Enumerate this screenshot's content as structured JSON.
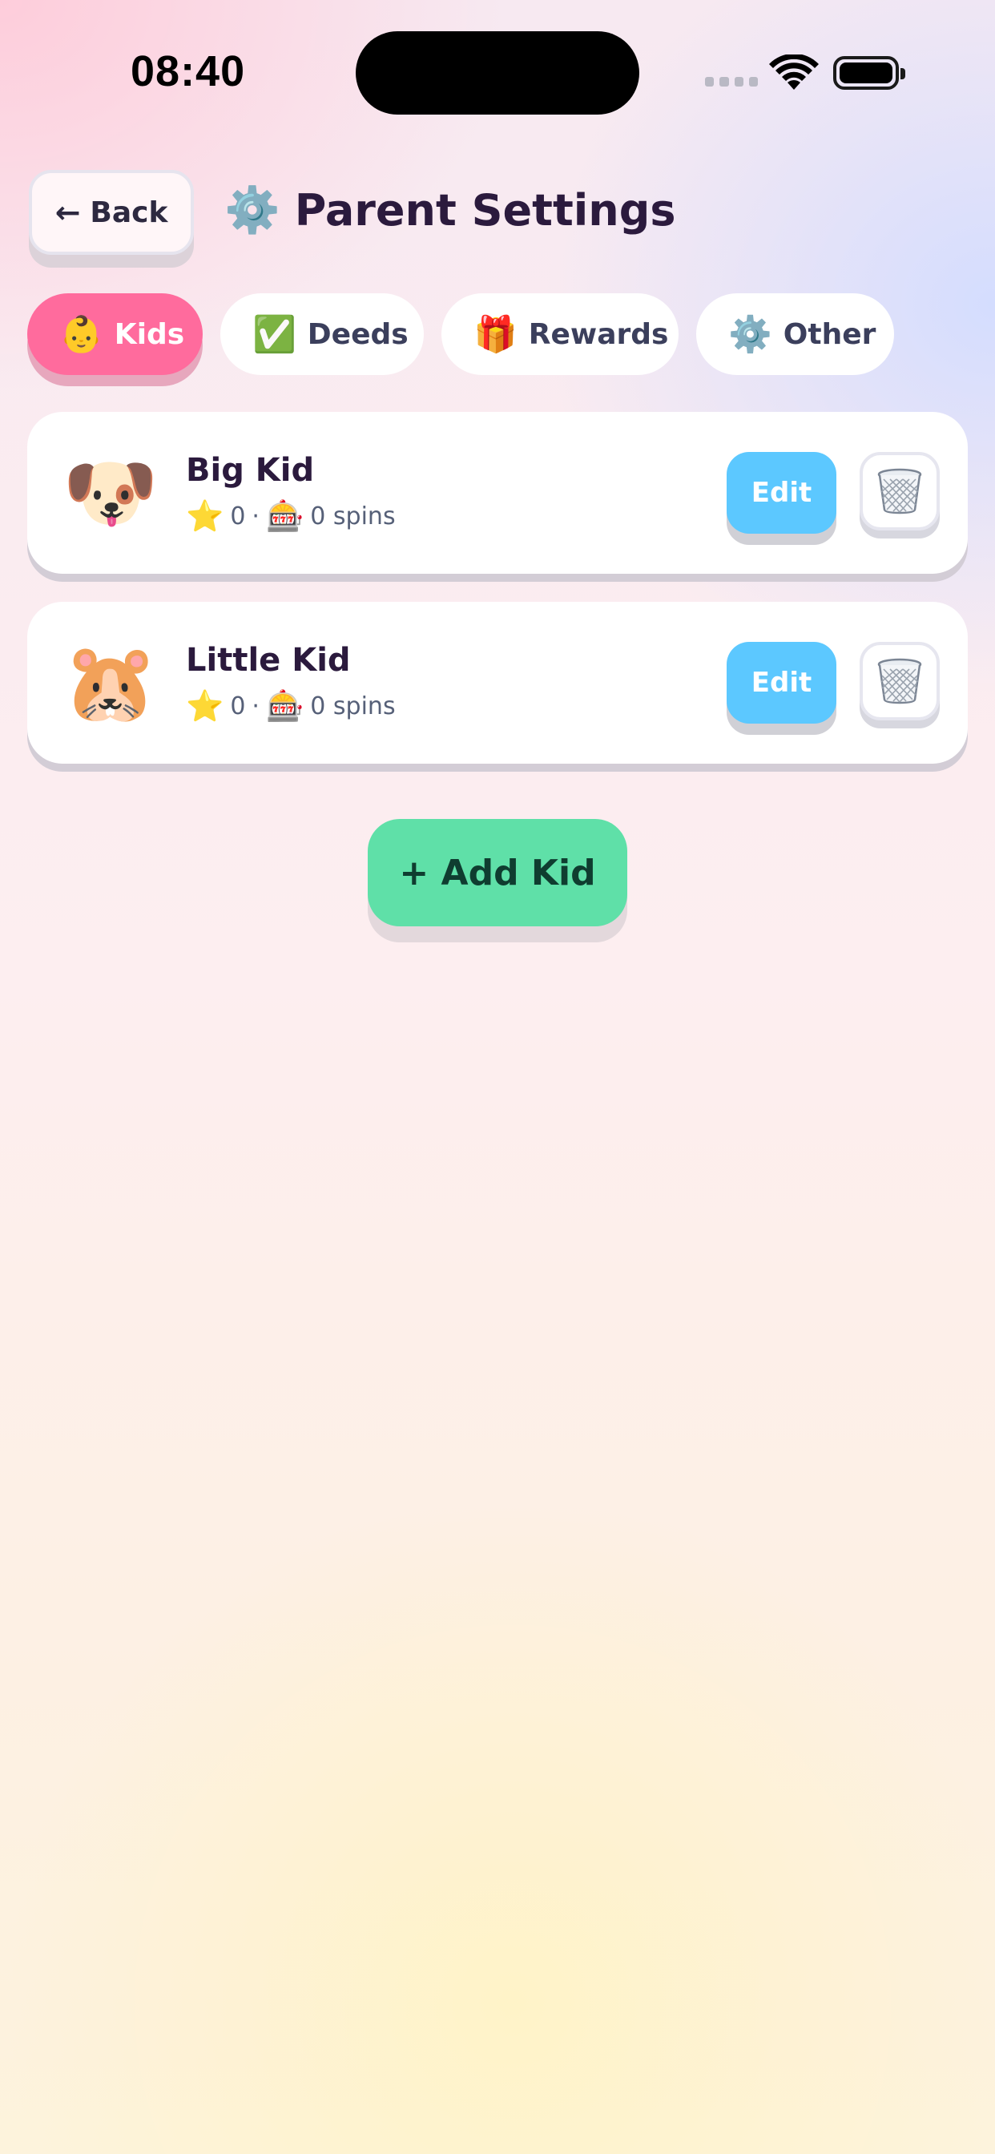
{
  "status_bar": {
    "time": "08:40"
  },
  "header": {
    "back_label": "Back",
    "back_icon": "arrow-left-icon",
    "title_icon": "⚙️",
    "title": "Parent Settings"
  },
  "tabs": [
    {
      "icon": "👶",
      "label": "Kids",
      "active": true
    },
    {
      "icon": "✅",
      "label": "Deeds",
      "active": false
    },
    {
      "icon": "🎁",
      "label": "Rewards",
      "active": false
    },
    {
      "icon": "⚙️",
      "label": "Other",
      "active": false
    }
  ],
  "kids": [
    {
      "avatar": "🐶",
      "name": "Big Kid",
      "star_icon": "⭐",
      "stars": "0",
      "separator": "·",
      "spin_icon": "🎰",
      "spins": "0 spins",
      "edit_label": "Edit",
      "delete_icon": "trash-basket-icon"
    },
    {
      "avatar": "🐹",
      "name": "Little Kid",
      "star_icon": "⭐",
      "stars": "0",
      "separator": "·",
      "spin_icon": "🎰",
      "spins": "0 spins",
      "edit_label": "Edit",
      "delete_icon": "trash-basket-icon"
    }
  ],
  "add_kid_label": "+ Add Kid",
  "colors": {
    "active_tab": "#ff6b9d",
    "edit_button": "#5cc8ff",
    "add_button": "#5fe0a8",
    "title_text": "#2b1a3d"
  }
}
